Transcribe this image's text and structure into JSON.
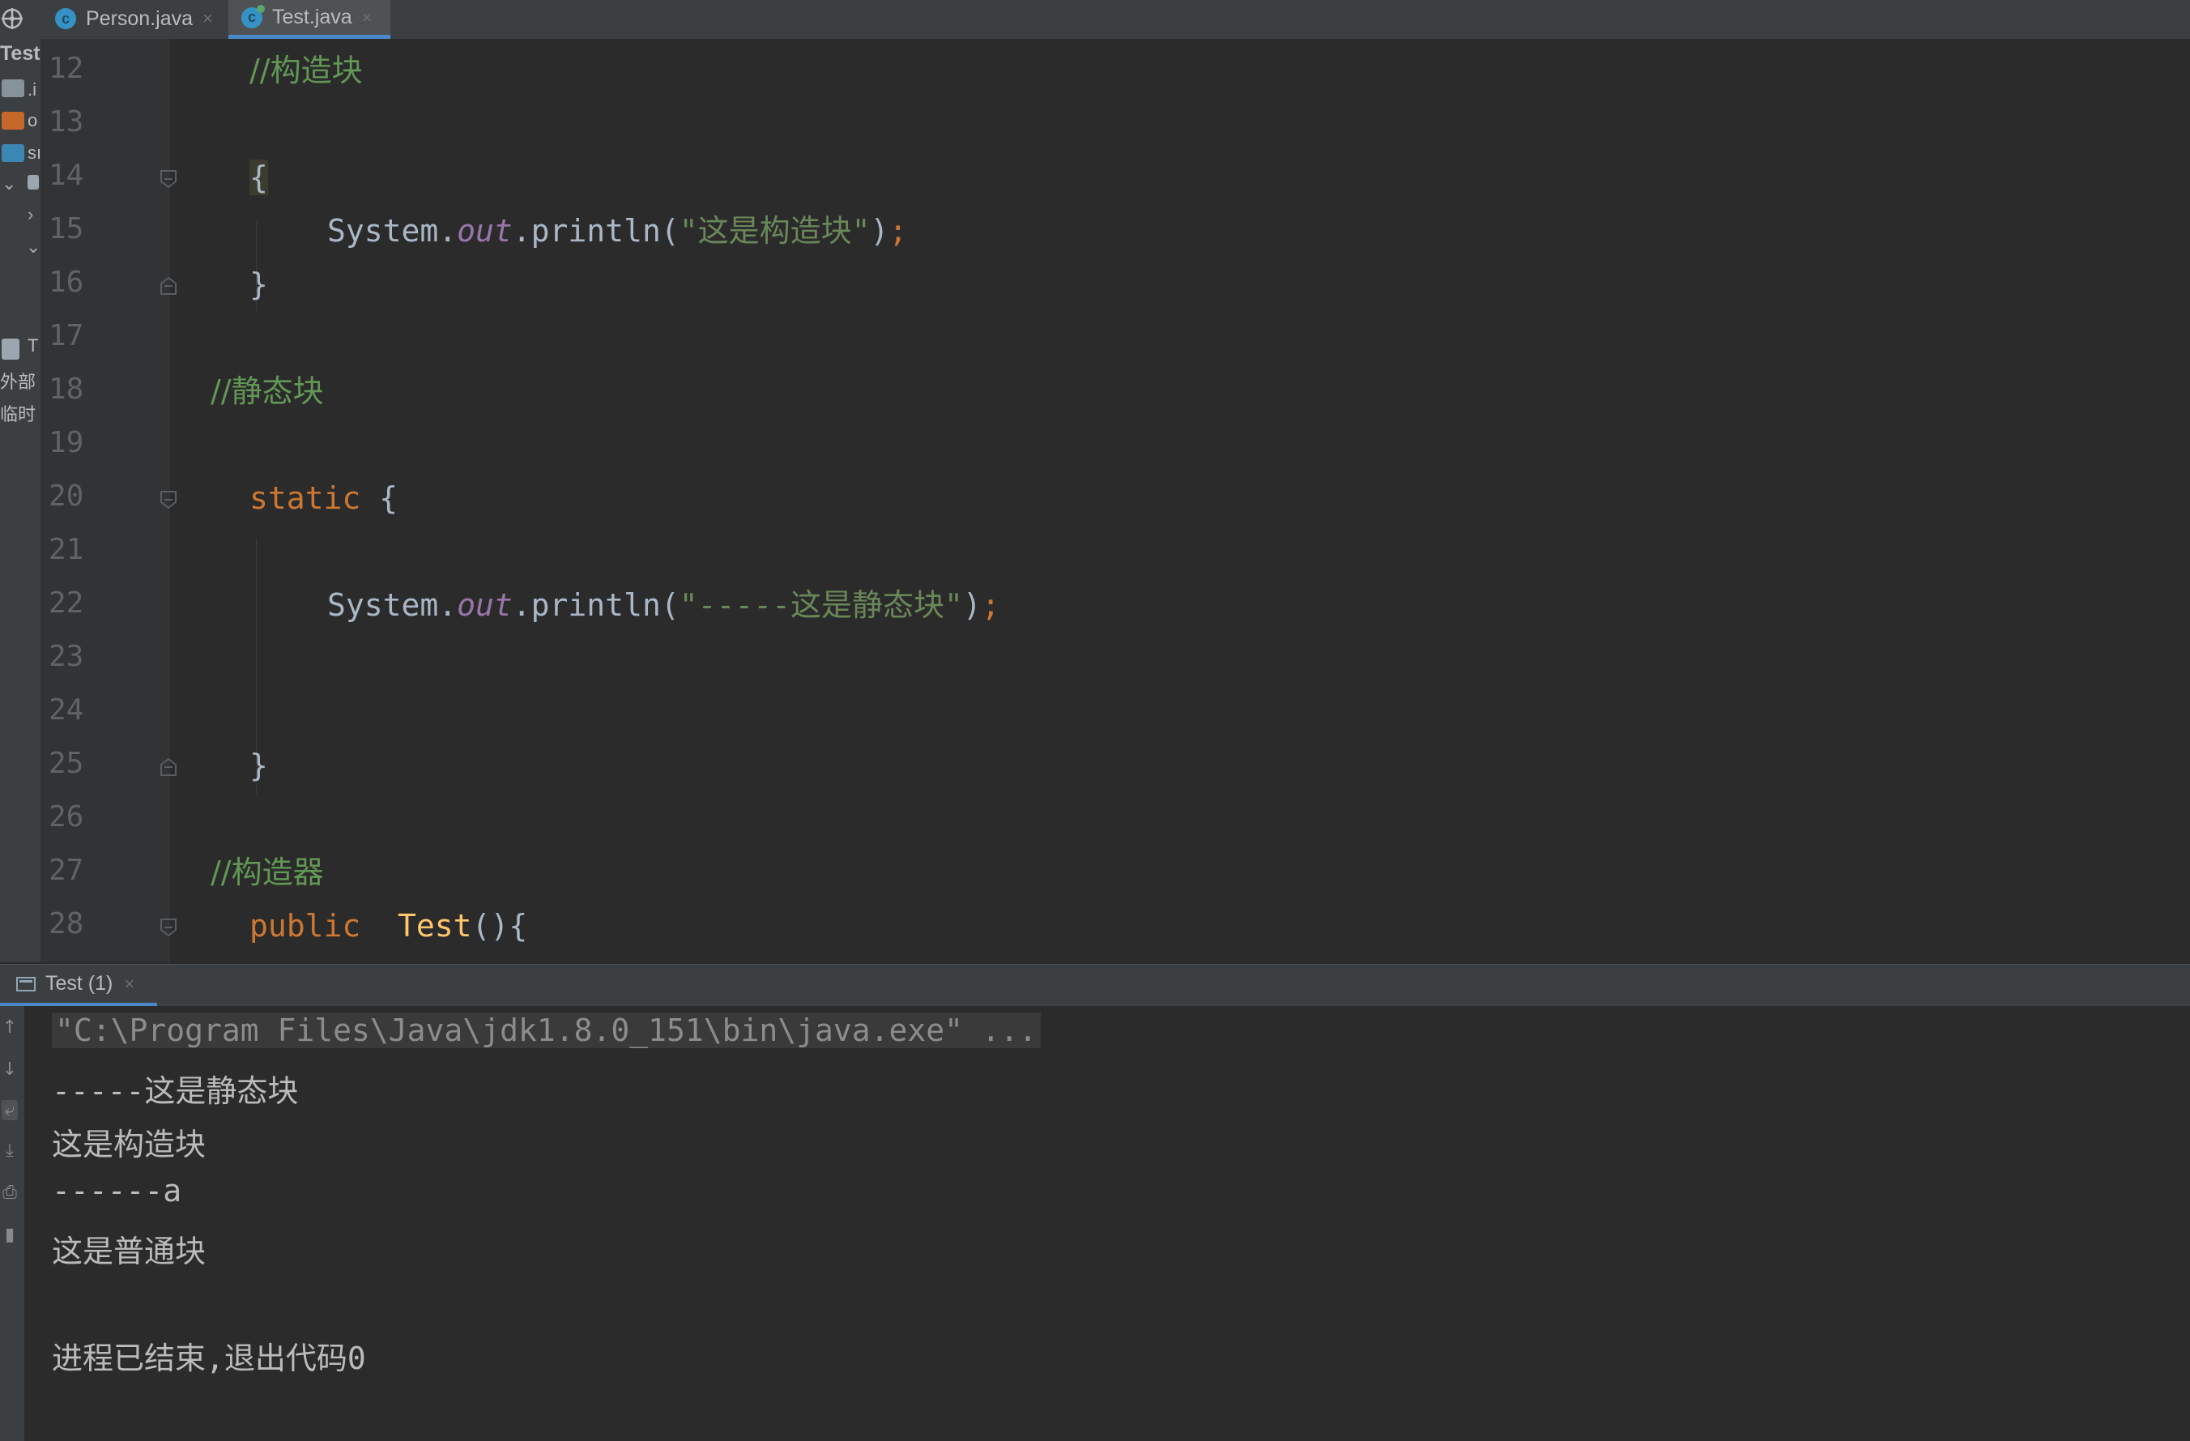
{
  "tabs": [
    {
      "label": "Person.java",
      "active": false
    },
    {
      "label": "Test.java",
      "active": true
    }
  ],
  "project": {
    "title": "Test",
    "items": [
      ".i",
      "o",
      "sı",
      "T",
      "外部",
      "临时"
    ]
  },
  "editor": {
    "lines": [
      {
        "num": "12",
        "parts": [
          {
            "t": "//构造块",
            "c": "cm"
          }
        ]
      },
      {
        "num": "13",
        "parts": []
      },
      {
        "num": "14",
        "parts": [
          {
            "t": "{",
            "c": "brace-hl"
          }
        ]
      },
      {
        "num": "15",
        "parts": [
          {
            "t": "System.",
            "c": "pl"
          },
          {
            "t": "out",
            "c": "it"
          },
          {
            "t": ".println(",
            "c": "pl"
          },
          {
            "t": "\"这是构造块\"",
            "c": "st"
          },
          {
            "t": ")",
            "c": "pl"
          },
          {
            "t": ";",
            "c": "kw"
          }
        ]
      },
      {
        "num": "16",
        "parts": [
          {
            "t": "}",
            "c": "pl"
          }
        ]
      },
      {
        "num": "17",
        "parts": []
      },
      {
        "num": "18",
        "parts": [
          {
            "t": "//静态块",
            "c": "cm"
          }
        ]
      },
      {
        "num": "19",
        "parts": []
      },
      {
        "num": "20",
        "parts": [
          {
            "t": "static",
            "c": "kw"
          },
          {
            "t": " {",
            "c": "pl"
          }
        ]
      },
      {
        "num": "21",
        "parts": []
      },
      {
        "num": "22",
        "parts": [
          {
            "t": "System.",
            "c": "pl"
          },
          {
            "t": "out",
            "c": "it"
          },
          {
            "t": ".println(",
            "c": "pl"
          },
          {
            "t": "\"-----这是静态块\"",
            "c": "st"
          },
          {
            "t": ")",
            "c": "pl"
          },
          {
            "t": ";",
            "c": "kw"
          }
        ]
      },
      {
        "num": "23",
        "parts": []
      },
      {
        "num": "24",
        "parts": []
      },
      {
        "num": "25",
        "parts": [
          {
            "t": "}",
            "c": "pl"
          }
        ]
      },
      {
        "num": "26",
        "parts": []
      },
      {
        "num": "27",
        "parts": [
          {
            "t": "//构造器",
            "c": "cm"
          }
        ]
      },
      {
        "num": "28",
        "parts": [
          {
            "t": "public",
            "c": "kw"
          },
          {
            "t": "  ",
            "c": "pl"
          },
          {
            "t": "Test",
            "c": "fn"
          },
          {
            "t": "(){",
            "c": "pl"
          }
        ]
      }
    ]
  },
  "run": {
    "tab_label": "Test (1)",
    "console": [
      "\"C:\\Program Files\\Java\\jdk1.8.0_151\\bin\\java.exe\" ...",
      "-----这是静态块",
      "这是构造块",
      "------a",
      "这是普通块",
      "",
      "进程已结束,退出代码0"
    ]
  },
  "colors": {
    "comment": "#629755",
    "keyword": "#cc7832",
    "string": "#6a8759",
    "static_field": "#9876aa",
    "method_decl": "#ffc66d",
    "plain": "#a9b7c6",
    "accent": "#4a88c7"
  },
  "icons": [
    "target-icon",
    "class-icon",
    "close-icon",
    "folder-icon",
    "fold-marker-icon",
    "console-icon",
    "up-arrow-icon",
    "down-arrow-icon",
    "soft-wrap-icon",
    "scroll-end-icon",
    "print-icon",
    "trash-icon"
  ]
}
